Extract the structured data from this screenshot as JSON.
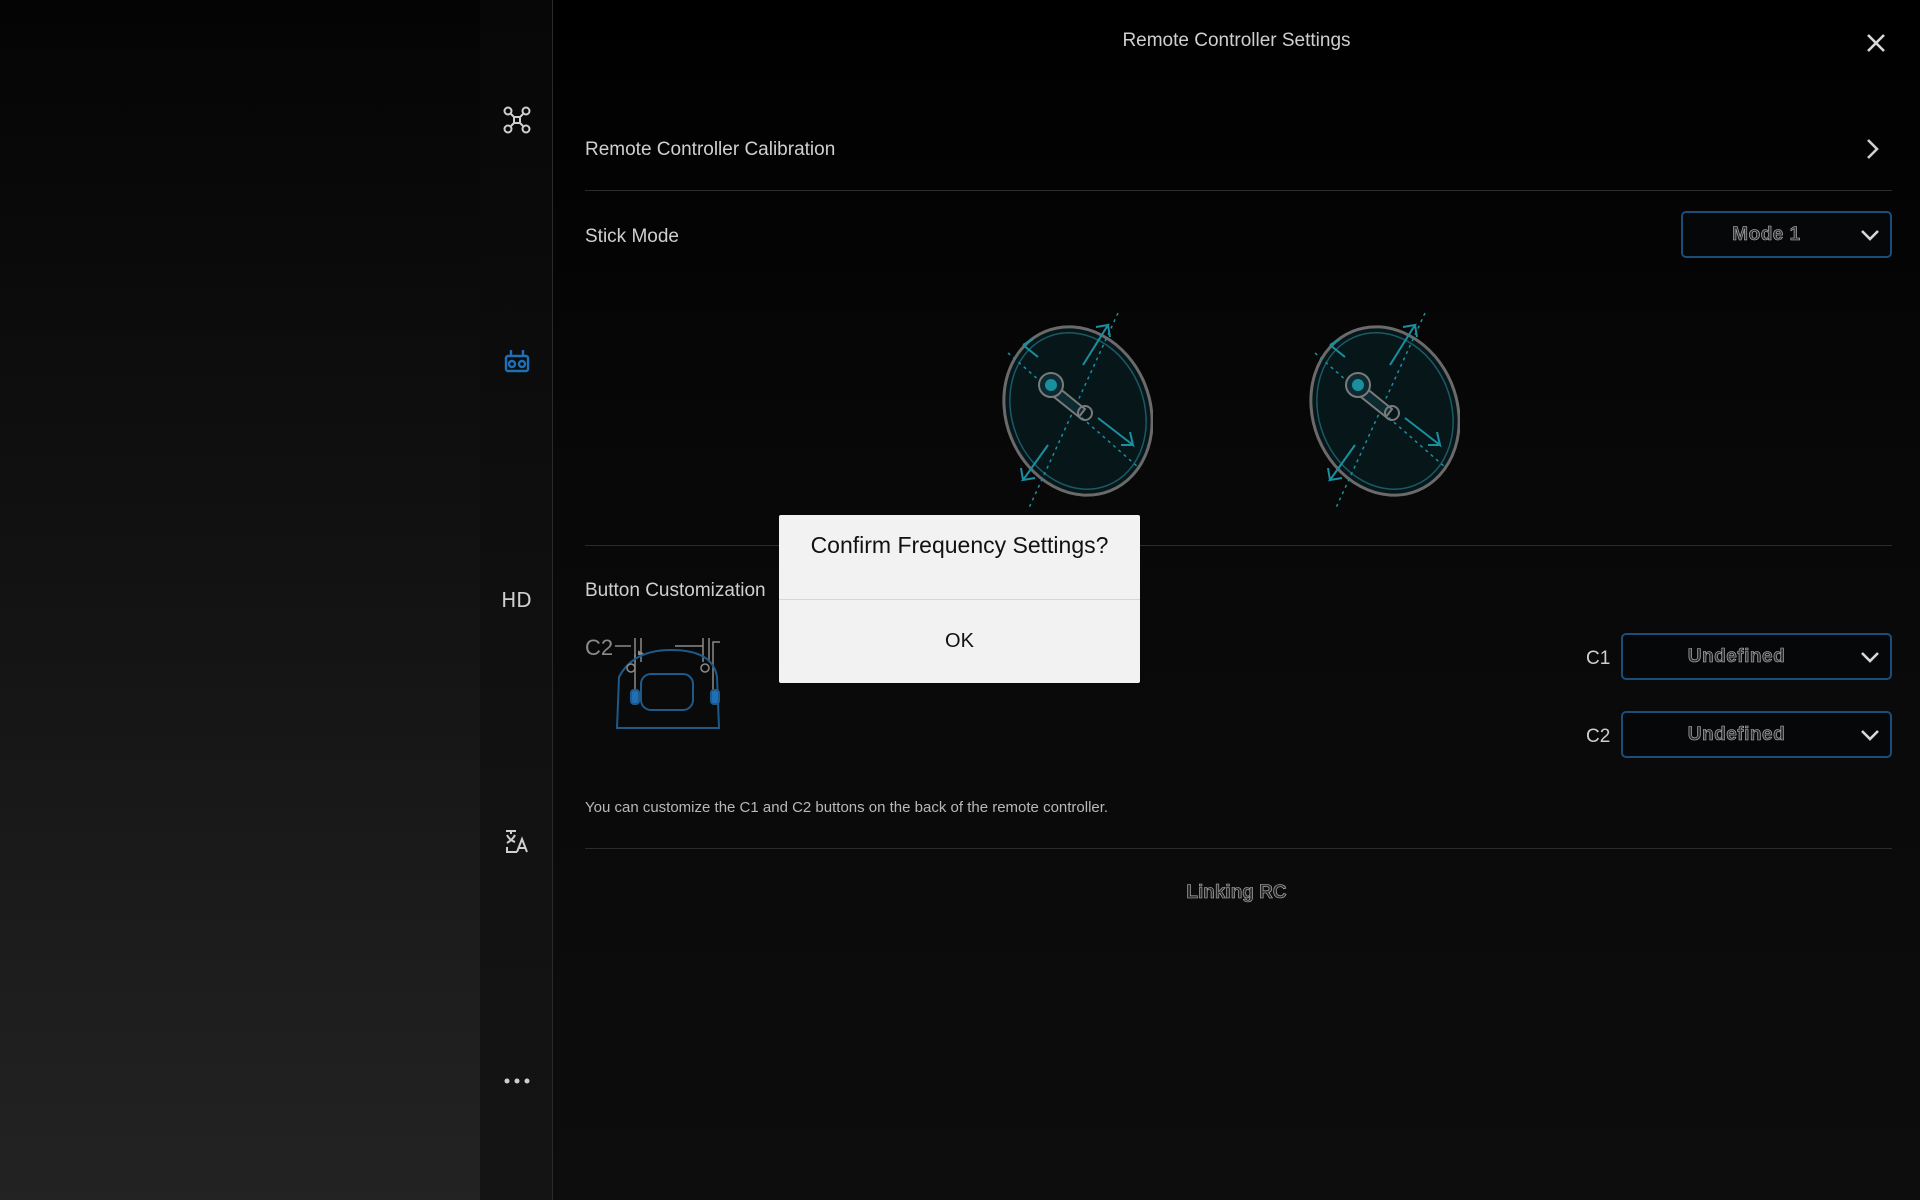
{
  "header": {
    "title": "Remote Controller Settings",
    "close_icon": "close-icon"
  },
  "rail": {
    "items": [
      {
        "icon": "drone-icon",
        "active": false
      },
      {
        "icon": "remote-controller-icon",
        "active": true
      },
      {
        "label": "HD",
        "active": false
      },
      {
        "icon": "language-icon",
        "active": false
      },
      {
        "icon": "more-icon",
        "active": false
      }
    ]
  },
  "calibration": {
    "label": "Remote Controller Calibration"
  },
  "stick_mode": {
    "label": "Stick Mode",
    "value": "Mode 1"
  },
  "button_customization": {
    "label": "Button Customization",
    "diagram_c2": "C2",
    "c1_label": "C1",
    "c1_value": "Undefined",
    "c2_label": "C2",
    "c2_value": "Undefined",
    "hint": "You can customize the C1 and C2 buttons on the back of the remote controller."
  },
  "linking": {
    "label": "Linking RC"
  },
  "dialog": {
    "title": "Confirm Frequency Settings?",
    "ok_label": "OK"
  },
  "colors": {
    "accent": "#1b4d7a",
    "icon_blue": "#1d6fb8",
    "stick_teal": "#1a8fa0"
  }
}
